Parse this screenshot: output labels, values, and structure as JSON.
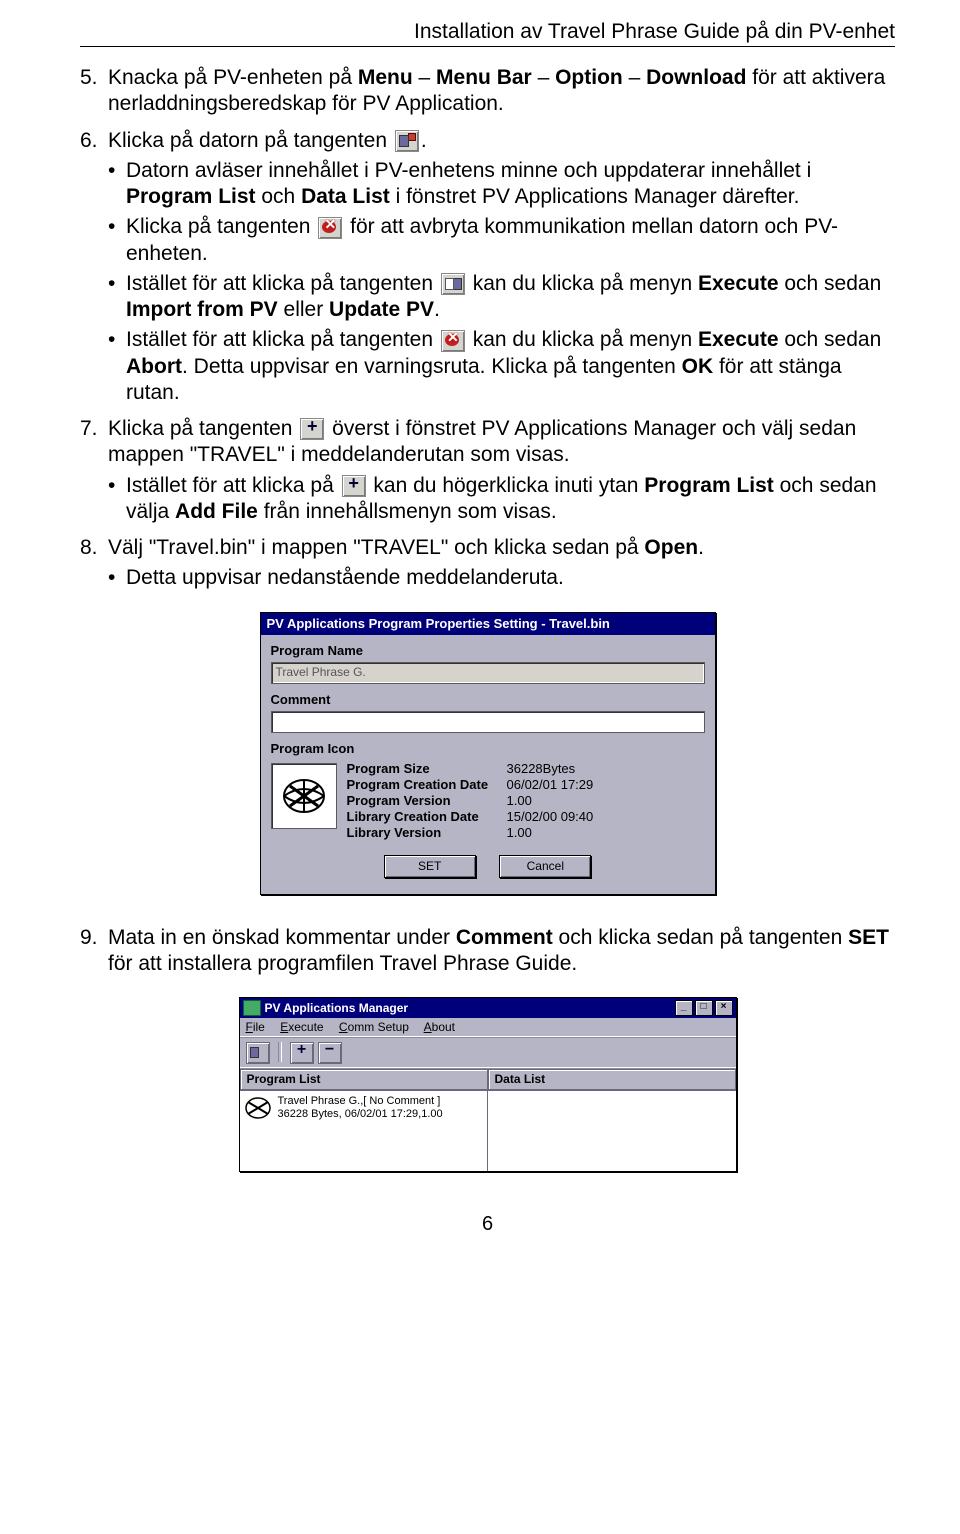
{
  "header": {
    "title": "Installation av Travel Phrase Guide på din PV-enhet"
  },
  "steps": {
    "s5": {
      "num": "5.",
      "t1": "Knacka på PV-enheten på ",
      "b1": "Menu",
      "t2": " – ",
      "b2": "Menu Bar",
      "t3": " – ",
      "b3": "Option",
      "t4": " – ",
      "b4": "Download",
      "t5": " för att aktivera nerladdningsberedskap för PV Application."
    },
    "s6": {
      "num": "6.",
      "t1": "Klicka på datorn på tangenten ",
      "t2": "."
    },
    "s6bul": {
      "a": {
        "t1": "Datorn avläser innehållet i PV-enhetens minne och uppdaterar innehållet i ",
        "b1": "Program List",
        "t2": " och ",
        "b2": "Data List",
        "t3": " i fönstret PV Applications Manager därefter."
      },
      "b": {
        "t1": "Klicka på tangenten ",
        "t2": " för att avbryta kommunikation mellan datorn och PV-enheten."
      },
      "c": {
        "t1": "Istället för att klicka på tangenten ",
        "t2": " kan du klicka på menyn ",
        "b1": "Execute",
        "t3": " och sedan ",
        "b2": "Import from PV",
        "t4": " eller ",
        "b3": "Update PV",
        "t5": "."
      },
      "d": {
        "t1": "Istället för att klicka på tangenten ",
        "t2": " kan du klicka på menyn ",
        "b1": "Execute",
        "t3": " och sedan ",
        "b2": "Abort",
        "t4": ". Detta uppvisar en varningsruta. Klicka på tangenten ",
        "b3": "OK",
        "t5": " för att stänga rutan."
      }
    },
    "s7": {
      "num": "7.",
      "t1": "Klicka på tangenten ",
      "t2": " överst i fönstret PV Applications Manager och välj sedan mappen \"TRAVEL\" i meddelanderutan som visas."
    },
    "s7bul": {
      "a": {
        "t1": "Istället för att klicka på ",
        "t2": " kan du högerklicka inuti ytan ",
        "b1": "Program List",
        "t3": " och sedan välja ",
        "b2": "Add File",
        "t4": " från innehållsmenyn som visas."
      }
    },
    "s8": {
      "num": "8.",
      "t1": "Välj \"Travel.bin\" i mappen \"TRAVEL\" och klicka sedan på ",
      "b1": "Open",
      "t2": "."
    },
    "s8bul": {
      "a": {
        "t1": "Detta uppvisar nedanstående meddelanderuta."
      }
    },
    "s9": {
      "num": "9.",
      "t1": "Mata in en önskad kommentar under ",
      "b1": "Comment",
      "t2": " och klicka sedan på tangenten ",
      "b2": "SET",
      "t3": " för att installera programfilen Travel Phrase Guide."
    }
  },
  "dialog1": {
    "title": "PV Applications Program Properties Setting - Travel.bin",
    "labels": {
      "program_name": "Program Name",
      "comment": "Comment",
      "program_icon": "Program Icon"
    },
    "program_name_value": "Travel Phrase G.",
    "props": {
      "size_label": "Program Size",
      "size_value": "36228Bytes",
      "cdate_label": "Program Creation Date",
      "cdate_value": "06/02/01 17:29",
      "ver_label": "Program Version",
      "ver_value": "1.00",
      "ldate_label": "Library Creation Date",
      "ldate_value": "15/02/00 09:40",
      "lver_label": "Library Version",
      "lver_value": "1.00"
    },
    "buttons": {
      "set": "SET",
      "cancel": "Cancel"
    }
  },
  "window2": {
    "title": "PV Applications Manager",
    "menu": {
      "file": "File",
      "execute": "Execute",
      "comm": "Comm Setup",
      "about": "About"
    },
    "headers": {
      "program_list": "Program List",
      "data_list": "Data List"
    },
    "item": {
      "line1": "Travel Phrase G.,[ No Comment ]",
      "line2": "36228 Bytes, 06/02/01 17:29,1.00"
    }
  },
  "page_num": "6",
  "bullet": "•"
}
